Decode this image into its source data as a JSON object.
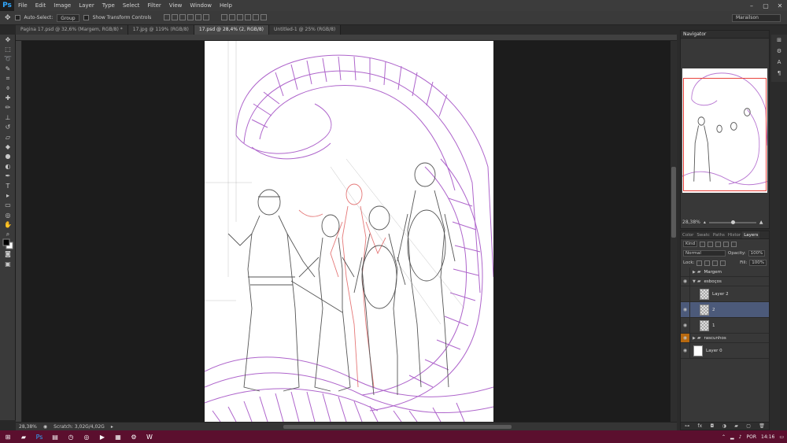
{
  "app": {
    "name": "Ps"
  },
  "menu": [
    "File",
    "Edit",
    "Image",
    "Layer",
    "Type",
    "Select",
    "Filter",
    "View",
    "Window",
    "Help"
  ],
  "options": {
    "auto_select_label": "Auto-Select:",
    "auto_select_value": "Group",
    "show_transform_label": "Show Transform Controls",
    "workspace": "Marailson"
  },
  "tabs": [
    {
      "label": "Pagina 17.psd @ 32,6% (Margem, RGB/8) *"
    },
    {
      "label": "17.jpg @ 119% (RGB/8)"
    },
    {
      "label": "17.psd @ 28,4% (2, RGB/8)"
    },
    {
      "label": "Untitled-1 @ 25% (RGB/8)"
    }
  ],
  "status": {
    "zoom": "28,38%",
    "scratch": "Scratch: 3,02G/4,02G"
  },
  "navigator": {
    "title": "Navigator",
    "zoom": "28,38%"
  },
  "layers_panel": {
    "tabs": [
      "Color",
      "Swatc",
      "Paths",
      "Histor",
      "Layers"
    ],
    "kind_label": "Kind",
    "blend_mode": "Normal",
    "opacity_label": "Opacity:",
    "opacity_value": "100%",
    "lock_label": "Lock:",
    "fill_label": "Fill:",
    "fill_value": "100%",
    "layers": [
      {
        "name": "Margem",
        "type": "group"
      },
      {
        "name": "esboços",
        "type": "group"
      },
      {
        "name": "Layer 2",
        "type": "layer"
      },
      {
        "name": "2",
        "type": "layer"
      },
      {
        "name": "1",
        "type": "layer"
      },
      {
        "name": "rascunhos",
        "type": "group"
      },
      {
        "name": "Layer 0",
        "type": "layer"
      }
    ]
  },
  "taskbar": {
    "language": "POR",
    "time": "14:16"
  },
  "colors": {
    "accent": "#31a8ff",
    "selection": "#4c5a7a",
    "taskbar": "#5b0f2e",
    "nav_box": "#e8433c"
  }
}
